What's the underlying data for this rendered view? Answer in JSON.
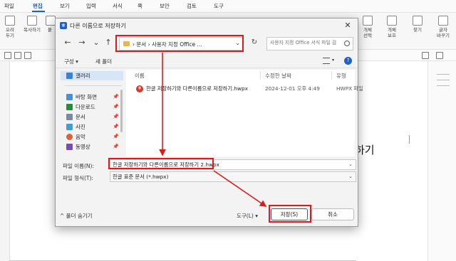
{
  "app": {
    "menu": [
      "파일",
      "편집",
      "보기",
      "입력",
      "서식",
      "쪽",
      "보안",
      "검토",
      "도구"
    ],
    "active_menu": "편집",
    "ribbon_left": [
      {
        "label": "오려\n두기",
        "icon": "scissors-icon"
      },
      {
        "label": "복사하기",
        "icon": "copy-icon"
      },
      {
        "label": "붙",
        "icon": "paste-icon"
      }
    ],
    "ribbon_right": [
      {
        "label": "개체\n선택",
        "icon": "select-object-icon"
      },
      {
        "label": "개체\n보호",
        "icon": "protect-object-icon"
      },
      {
        "label": "찾기",
        "icon": "find-icon"
      },
      {
        "label": "글자\n바꾸기",
        "icon": "replace-icon"
      }
    ],
    "doc_text": "하기"
  },
  "dialog": {
    "title": "다른 이름으로 저장하기",
    "close": "✕",
    "nav": {
      "back": "←",
      "forward": "→",
      "down": "⌄",
      "up": "↑"
    },
    "path": "›  문서  ›  사용자 지정 Office ...",
    "search_placeholder": "사용자 지정 Office 서식 파일 검",
    "commands": {
      "organize": "구성 ▾",
      "new_folder": "새 폴더",
      "help": "?"
    },
    "nav_pane": [
      {
        "label": "갤러리",
        "icon": "gallery-icon",
        "color": "#3c7fd6",
        "pinned": false,
        "selected": true
      },
      {
        "label": "바탕 화면",
        "icon": "desktop-icon",
        "color": "#4a90d9",
        "pinned": true,
        "selected": false
      },
      {
        "label": "다운로드",
        "icon": "download-icon",
        "color": "#2a8a3a",
        "pinned": true,
        "selected": false
      },
      {
        "label": "문서",
        "icon": "documents-icon",
        "color": "#7a8aa0",
        "pinned": true,
        "selected": false
      },
      {
        "label": "사진",
        "icon": "pictures-icon",
        "color": "#3aa0d8",
        "pinned": true,
        "selected": false
      },
      {
        "label": "음악",
        "icon": "music-icon",
        "color": "#e0603a",
        "pinned": true,
        "selected": false
      },
      {
        "label": "동영상",
        "icon": "videos-icon",
        "color": "#7a4ab8",
        "pinned": true,
        "selected": false
      }
    ],
    "columns": [
      "이름",
      "수정한 날짜",
      "유형"
    ],
    "files": [
      {
        "name": "한글 저장하기와 다른이름으로 저장하기.hwpx",
        "date": "2024-12-01 오후 4:49",
        "type": "HWPX 파일"
      }
    ],
    "filename_label": "파일 이름(N):",
    "filename_value": "한글 저장하기와 다른이름으로 저장하기 2.hwpx",
    "filetype_label": "파일 형식(T):",
    "filetype_value": "한글 표준 문서 (*.hwpx)",
    "hide_folders": "^ 폴더 숨기기",
    "tools": "도구(L)  ▾",
    "save_button": "저장(S)",
    "cancel_button": "취소"
  }
}
